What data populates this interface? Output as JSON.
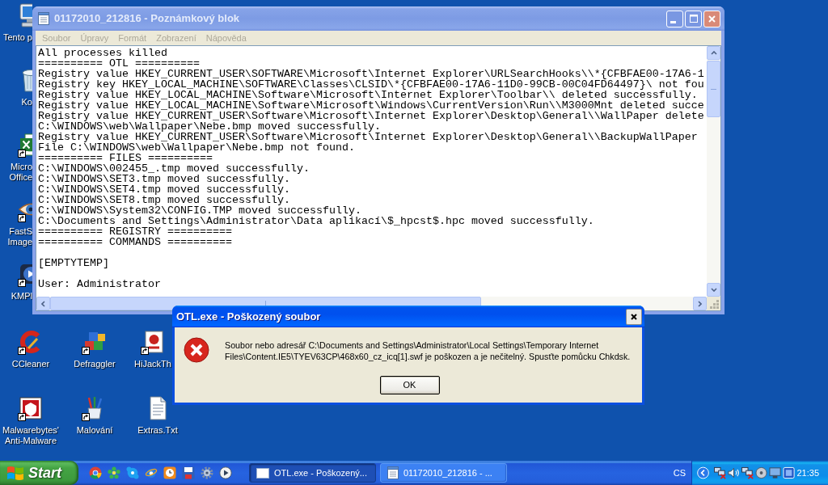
{
  "desktop_icons": [
    {
      "label": "Tento p",
      "shortcut": false
    },
    {
      "label": "Ko",
      "shortcut": false
    },
    {
      "label": "Micro Office",
      "shortcut": true
    },
    {
      "label": "FastS Image",
      "shortcut": true
    },
    {
      "label": "KMPl",
      "shortcut": true
    },
    {
      "label": "CCleaner",
      "shortcut": true
    },
    {
      "label": "Defraggler",
      "shortcut": true
    },
    {
      "label": "HiJackTh",
      "shortcut": true
    },
    {
      "label": "Malwarebytes' Anti-Malware",
      "shortcut": true
    },
    {
      "label": "Malování",
      "shortcut": true
    },
    {
      "label": "Extras.Txt",
      "shortcut": false
    }
  ],
  "notepad": {
    "title": "01172010_212816 - Poznámkový blok",
    "active": false,
    "menu": [
      "Soubor",
      "Úpravy",
      "Formát",
      "Zobrazení",
      "Nápověda"
    ],
    "text": "All processes killed\n========== OTL ==========\nRegistry value HKEY_CURRENT_USER\\SOFTWARE\\Microsoft\\Internet Explorer\\URLSearchHooks\\\\*{CFBFAE00-17A6-1\nRegistry key HKEY_LOCAL_MACHINE\\SOFTWARE\\Classes\\CLSID\\*{CFBFAE00-17A6-11D0-99CB-00C04FD64497}\\ not fou\nRegistry value HKEY_LOCAL_MACHINE\\Software\\Microsoft\\Internet Explorer\\Toolbar\\\\ deleted successfully.\nRegistry value HKEY_LOCAL_MACHINE\\Software\\Microsoft\\Windows\\CurrentVersion\\Run\\\\M3000Mnt deleted succe\nRegistry value HKEY_CURRENT_USER\\Software\\Microsoft\\Internet Explorer\\Desktop\\General\\\\WallPaper delete\nC:\\WINDOWS\\web\\Wallpaper\\Nebe.bmp moved successfully.\nRegistry value HKEY_CURRENT_USER\\Software\\Microsoft\\Internet Explorer\\Desktop\\General\\\\BackupWallPaper\nFile C:\\WINDOWS\\web\\Wallpaper\\Nebe.bmp not found.\n========== FILES ==========\nC:\\WINDOWS\\002455_.tmp moved successfully.\nC:\\WINDOWS\\SET3.tmp moved successfully.\nC:\\WINDOWS\\SET4.tmp moved successfully.\nC:\\WINDOWS\\SET8.tmp moved successfully.\nC:\\WINDOWS\\System32\\CONFIG.TMP moved successfully.\nC:\\Documents and Settings\\Administrator\\Data aplikací\\$_hpcst$.hpc moved successfully.\n========== REGISTRY ==========\n========== COMMANDS ==========\n\n[EMPTYTEMP]\n\nUser: Administrator"
  },
  "dialog": {
    "title": "OTL.exe - Poškozený soubor",
    "active": true,
    "message": "Soubor nebo adresář C:\\Documents and Settings\\Administrator\\Local Settings\\Temporary Internet Files\\Content.IE5\\TYEV63CP\\468x60_cz_icq[1].swf je poškozen a je nečitelný. Spusťte pomůcku Chkdsk.",
    "buttons": [
      "OK"
    ]
  },
  "taskbar": {
    "start": "Start",
    "tasks": [
      {
        "label": "OTL.exe - Poškozený...",
        "selected": true
      },
      {
        "label": "01172010_212816 - ...",
        "selected": false
      }
    ],
    "language": "CS",
    "clock": "21:35"
  }
}
